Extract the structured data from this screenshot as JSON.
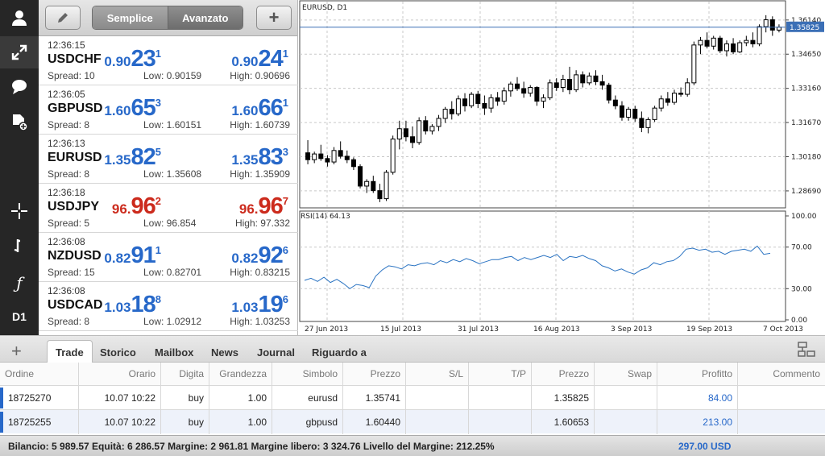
{
  "toolbar": {
    "timeframe": "D1",
    "icons": [
      "user-icon",
      "expand-icon",
      "chat-icon",
      "add-document-icon",
      "crosshair-icon",
      "chart-type-icon",
      "indicator-icon"
    ]
  },
  "quotes_header": {
    "segments": [
      "Semplice",
      "Avanzato"
    ],
    "edit_icon": "pencil-icon",
    "add_icon": "+"
  },
  "quotes": [
    {
      "time": "12:36:15",
      "symbol": "USDCHF",
      "spread": "Spread: 10",
      "low": "Low: 0.90159",
      "high": "High: 0.90696",
      "bid": [
        "0.90",
        "23",
        "1"
      ],
      "ask": [
        "0.90",
        "24",
        "1"
      ],
      "color": "blue"
    },
    {
      "time": "12:36:05",
      "symbol": "GBPUSD",
      "spread": "Spread: 8",
      "low": "Low: 1.60151",
      "high": "High: 1.60739",
      "bid": [
        "1.60",
        "65",
        "3"
      ],
      "ask": [
        "1.60",
        "66",
        "1"
      ],
      "color": "blue"
    },
    {
      "time": "12:36:13",
      "symbol": "EURUSD",
      "spread": "Spread: 8",
      "low": "Low: 1.35608",
      "high": "High: 1.35909",
      "bid": [
        "1.35",
        "82",
        "5"
      ],
      "ask": [
        "1.35",
        "83",
        "3"
      ],
      "color": "blue"
    },
    {
      "time": "12:36:18",
      "symbol": "USDJPY",
      "spread": "Spread: 5",
      "low": "Low: 96.854",
      "high": "High: 97.332",
      "bid": [
        "96.",
        "96",
        "2"
      ],
      "ask": [
        "96.",
        "96",
        "7"
      ],
      "color": "red"
    },
    {
      "time": "12:36:08",
      "symbol": "NZDUSD",
      "spread": "Spread: 15",
      "low": "Low: 0.82701",
      "high": "High: 0.83215",
      "bid": [
        "0.82",
        "91",
        "1"
      ],
      "ask": [
        "0.82",
        "92",
        "6"
      ],
      "color": "blue"
    },
    {
      "time": "12:36:08",
      "symbol": "USDCAD",
      "spread": "Spread: 8",
      "low": "Low: 1.02912",
      "high": "High: 1.03253",
      "bid": [
        "1.03",
        "18",
        "8"
      ],
      "ask": [
        "1.03",
        "19",
        "6"
      ],
      "color": "blue"
    }
  ],
  "chart": {
    "title": "EURUSD, D1",
    "current_price": "1.35825",
    "price_ticks": [
      "1.36140",
      "1.34650",
      "1.33160",
      "1.31670",
      "1.30180",
      "1.28690"
    ],
    "rsi_label": "RSI(14) 64.13",
    "rsi_ticks": [
      "100.00",
      "70.00",
      "30.00",
      "0.00"
    ],
    "date_labels": [
      "27 Jun 2013",
      "15 Jul 2013",
      "31 Jul 2013",
      "16 Aug 2013",
      "3 Sep 2013",
      "19 Sep 2013",
      "7 Oct 2013"
    ],
    "ylim": [
      1.2795,
      1.3645
    ]
  },
  "chart_data": {
    "type": "candlestick",
    "series": [
      {
        "values": [
          [
            1.3035,
            1.309,
            1.2985,
            1.3005
          ],
          [
            1.3005,
            1.304,
            1.299,
            1.303
          ],
          [
            1.303,
            1.307,
            1.3,
            1.301
          ],
          [
            1.301,
            1.3025,
            1.2975,
            1.2995
          ],
          [
            1.2995,
            1.306,
            1.2985,
            1.3045
          ],
          [
            1.3045,
            1.3085,
            1.301,
            1.302
          ],
          [
            1.302,
            1.3045,
            1.299,
            1.3005
          ],
          [
            1.3005,
            1.3015,
            1.296,
            1.2975
          ],
          [
            1.2975,
            1.2985,
            1.288,
            1.289
          ],
          [
            1.289,
            1.292,
            1.286,
            1.291
          ],
          [
            1.291,
            1.2935,
            1.286,
            1.287
          ],
          [
            1.287,
            1.29,
            1.282,
            1.2835
          ],
          [
            1.2835,
            1.296,
            1.2825,
            1.295
          ],
          [
            1.295,
            1.311,
            1.294,
            1.3095
          ],
          [
            1.3095,
            1.3175,
            1.305,
            1.314
          ],
          [
            1.314,
            1.3175,
            1.3085,
            1.3105
          ],
          [
            1.3105,
            1.315,
            1.3055,
            1.308
          ],
          [
            1.308,
            1.319,
            1.307,
            1.3175
          ],
          [
            1.3175,
            1.3195,
            1.3115,
            1.313
          ],
          [
            1.313,
            1.316,
            1.3115,
            1.315
          ],
          [
            1.315,
            1.32,
            1.313,
            1.3185
          ],
          [
            1.3185,
            1.3235,
            1.3165,
            1.3225
          ],
          [
            1.3225,
            1.326,
            1.318,
            1.3205
          ],
          [
            1.3205,
            1.3285,
            1.3195,
            1.327
          ],
          [
            1.327,
            1.3295,
            1.3215,
            1.324
          ],
          [
            1.324,
            1.33,
            1.323,
            1.329
          ],
          [
            1.329,
            1.3305,
            1.323,
            1.325
          ],
          [
            1.325,
            1.3285,
            1.32,
            1.323
          ],
          [
            1.323,
            1.329,
            1.321,
            1.3275
          ],
          [
            1.3275,
            1.33,
            1.324,
            1.326
          ],
          [
            1.326,
            1.332,
            1.3245,
            1.3305
          ],
          [
            1.3305,
            1.3345,
            1.328,
            1.3335
          ],
          [
            1.3335,
            1.3365,
            1.3305,
            1.3315
          ],
          [
            1.3315,
            1.3345,
            1.3275,
            1.3295
          ],
          [
            1.3295,
            1.333,
            1.328,
            1.332
          ],
          [
            1.332,
            1.3325,
            1.324,
            1.326
          ],
          [
            1.326,
            1.329,
            1.323,
            1.3275
          ],
          [
            1.3275,
            1.3355,
            1.3265,
            1.334
          ],
          [
            1.334,
            1.336,
            1.3305,
            1.332
          ],
          [
            1.332,
            1.3375,
            1.33,
            1.3355
          ],
          [
            1.3355,
            1.341,
            1.329,
            1.331
          ],
          [
            1.331,
            1.3395,
            1.33,
            1.3375
          ],
          [
            1.3375,
            1.339,
            1.332,
            1.334
          ],
          [
            1.334,
            1.3385,
            1.333,
            1.337
          ],
          [
            1.337,
            1.3395,
            1.333,
            1.3345
          ],
          [
            1.3345,
            1.3375,
            1.331,
            1.333
          ],
          [
            1.333,
            1.334,
            1.325,
            1.3265
          ],
          [
            1.3265,
            1.3285,
            1.3225,
            1.324
          ],
          [
            1.324,
            1.326,
            1.3175,
            1.319
          ],
          [
            1.319,
            1.3235,
            1.3175,
            1.3225
          ],
          [
            1.3225,
            1.324,
            1.317,
            1.3185
          ],
          [
            1.3185,
            1.3215,
            1.3125,
            1.3145
          ],
          [
            1.3145,
            1.319,
            1.312,
            1.318
          ],
          [
            1.318,
            1.324,
            1.317,
            1.323
          ],
          [
            1.323,
            1.3285,
            1.3215,
            1.327
          ],
          [
            1.327,
            1.33,
            1.324,
            1.3255
          ],
          [
            1.3255,
            1.331,
            1.3245,
            1.3295
          ],
          [
            1.3295,
            1.332,
            1.328,
            1.329
          ],
          [
            1.329,
            1.336,
            1.328,
            1.334
          ],
          [
            1.334,
            1.352,
            1.333,
            1.3505
          ],
          [
            1.3505,
            1.354,
            1.3465,
            1.3525
          ],
          [
            1.3525,
            1.356,
            1.349,
            1.35
          ],
          [
            1.35,
            1.3545,
            1.3485,
            1.3535
          ],
          [
            1.3535,
            1.3545,
            1.347,
            1.348
          ],
          [
            1.348,
            1.3525,
            1.3455,
            1.351
          ],
          [
            1.351,
            1.3535,
            1.3465,
            1.3475
          ],
          [
            1.3475,
            1.3525,
            1.347,
            1.3515
          ],
          [
            1.3515,
            1.3545,
            1.35,
            1.3525
          ],
          [
            1.3525,
            1.356,
            1.3495,
            1.351
          ],
          [
            1.351,
            1.3595,
            1.35,
            1.3585
          ],
          [
            1.3585,
            1.3635,
            1.356,
            1.3615
          ],
          [
            1.3615,
            1.363,
            1.3545,
            1.357
          ],
          [
            1.357,
            1.3595,
            1.356,
            1.3583
          ]
        ]
      }
    ],
    "rsi": [
      38,
      40,
      37,
      41,
      36,
      39,
      35,
      30,
      34,
      33,
      31,
      42,
      48,
      52,
      51,
      49,
      53,
      52,
      54,
      55,
      53,
      57,
      55,
      58,
      56,
      59,
      57,
      54,
      56,
      58,
      58,
      60,
      61,
      57,
      60,
      58,
      60,
      62,
      60,
      63,
      57,
      61,
      60,
      62,
      59,
      57,
      52,
      50,
      47,
      49,
      46,
      44,
      48,
      50,
      55,
      53,
      56,
      57,
      61,
      68,
      69,
      67,
      68,
      65,
      66,
      63,
      66,
      67,
      68,
      66,
      71,
      63,
      64
    ],
    "ylim": [
      1.2795,
      1.3645
    ],
    "rsi_ylim": [
      0,
      100
    ]
  },
  "tabs": [
    "Trade",
    "Storico",
    "Mailbox",
    "News",
    "Journal",
    "Riguardo a"
  ],
  "table": {
    "headers": [
      "Ordine",
      "Orario",
      "Digita",
      "Grandezza",
      "Simbolo",
      "Prezzo",
      "S/L",
      "T/P",
      "Prezzo",
      "Swap",
      "Profitto",
      "Commento"
    ],
    "rows": [
      [
        "18725270",
        "10.07 10:22",
        "buy",
        "1.00",
        "eurusd",
        "1.35741",
        "",
        "",
        "1.35825",
        "",
        "84.00",
        ""
      ],
      [
        "18725255",
        "10.07 10:22",
        "buy",
        "1.00",
        "gbpusd",
        "1.60440",
        "",
        "",
        "1.60653",
        "",
        "213.00",
        ""
      ]
    ]
  },
  "status": {
    "text": "Bilancio: 5 989.57 Equità: 6 286.57 Margine: 2 961.81 Margine libero: 3 324.76 Livello del Margine: 212.25%",
    "total": "297.00  USD"
  }
}
